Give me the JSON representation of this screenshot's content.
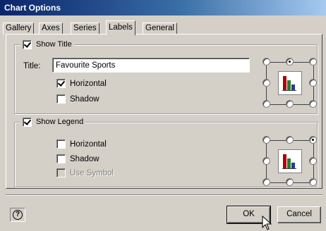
{
  "window": {
    "title": "Chart Options"
  },
  "tabs": [
    {
      "label": "Gallery"
    },
    {
      "label": "Axes"
    },
    {
      "label": "Series"
    },
    {
      "label": "Labels",
      "active": true
    },
    {
      "label": "General"
    }
  ],
  "title_group": {
    "label": "Show Title",
    "checked": true,
    "title_label": "Title:",
    "title_value": "Favourite Sports",
    "horizontal_label": "Horizontal",
    "horizontal_checked": true,
    "shadow_label": "Shadow",
    "shadow_checked": false
  },
  "legend_group": {
    "label": "Show Legend",
    "checked": true,
    "horizontal_label": "Horizontal",
    "horizontal_checked": false,
    "shadow_label": "Shadow",
    "shadow_checked": false,
    "use_symbol_label": "Use Symbol",
    "use_symbol_enabled": false
  },
  "buttons": {
    "ok": "OK",
    "cancel": "Cancel",
    "help_icon": "question-icon"
  },
  "colors": {
    "titlebar_start": "#0a246a",
    "titlebar_end": "#a6caf0",
    "face": "#d4d0c8"
  }
}
